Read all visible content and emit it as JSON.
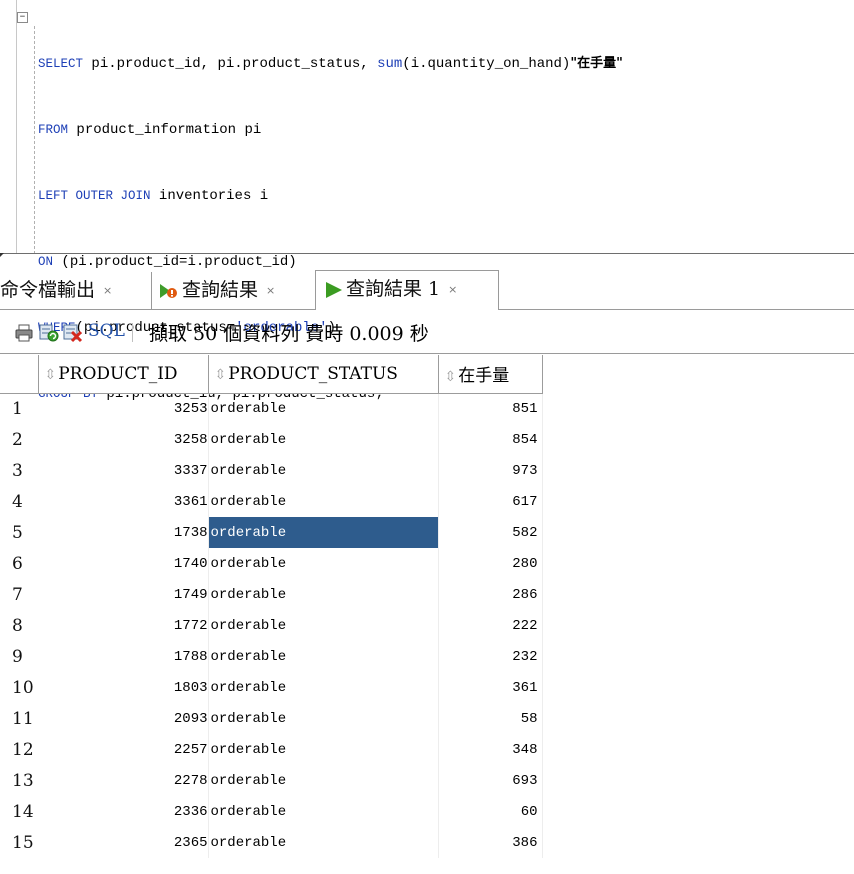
{
  "editor": {
    "fold_symbol": "−",
    "lines": [
      {
        "kw": "SELECT",
        "text": " pi.product_id, pi.product_status, ",
        "fn": "sum",
        "text2": "(i.quantity_on_hand)",
        "cjk": "\"在手量\""
      },
      {
        "kw": "FROM",
        "text": " product_information pi"
      },
      {
        "kw": "LEFT OUTER JOIN",
        "text": " inventories i"
      },
      {
        "kw": "ON",
        "text": " (pi.product_id=i.product_id)"
      },
      {
        "kw": "WHERE",
        "text": "(pi.product_status=",
        "str": "'orderable'",
        "text2": ")"
      },
      {
        "kw": "GROUP BY",
        "text": " pi.product_id, pi.product_status;"
      }
    ]
  },
  "tabs": [
    {
      "label": "命令檔輸出",
      "close": "×",
      "active": false
    },
    {
      "label": "查詢結果",
      "close": "×",
      "active": false
    },
    {
      "label": "查詢結果 1",
      "close": "×",
      "active": true
    }
  ],
  "toolbar": {
    "sql_label": "SQL",
    "status": "擷取 50 個資料列 費時 0.009 秒"
  },
  "grid": {
    "sort_glyph": "⇳",
    "columns": [
      "PRODUCT_ID",
      "PRODUCT_STATUS",
      "在手量"
    ],
    "rows": [
      {
        "n": "1",
        "id": "3253",
        "status": "orderable",
        "qty": "851"
      },
      {
        "n": "2",
        "id": "3258",
        "status": "orderable",
        "qty": "854"
      },
      {
        "n": "3",
        "id": "3337",
        "status": "orderable",
        "qty": "973"
      },
      {
        "n": "4",
        "id": "3361",
        "status": "orderable",
        "qty": "617"
      },
      {
        "n": "5",
        "id": "1738",
        "status": "orderable",
        "qty": "582"
      },
      {
        "n": "6",
        "id": "1740",
        "status": "orderable",
        "qty": "280"
      },
      {
        "n": "7",
        "id": "1749",
        "status": "orderable",
        "qty": "286"
      },
      {
        "n": "8",
        "id": "1772",
        "status": "orderable",
        "qty": "222"
      },
      {
        "n": "9",
        "id": "1788",
        "status": "orderable",
        "qty": "232"
      },
      {
        "n": "10",
        "id": "1803",
        "status": "orderable",
        "qty": "361"
      },
      {
        "n": "11",
        "id": "2093",
        "status": "orderable",
        "qty": "58"
      },
      {
        "n": "12",
        "id": "2257",
        "status": "orderable",
        "qty": "348"
      },
      {
        "n": "13",
        "id": "2278",
        "status": "orderable",
        "qty": "693"
      },
      {
        "n": "14",
        "id": "2336",
        "status": "orderable",
        "qty": "60"
      },
      {
        "n": "15",
        "id": "2365",
        "status": "orderable",
        "qty": "386"
      }
    ],
    "selected_row": 4,
    "selection_color": "#2e5c8d"
  },
  "colors": {
    "keyword": "#1d3fb6",
    "sql_link": "#2150a8"
  }
}
